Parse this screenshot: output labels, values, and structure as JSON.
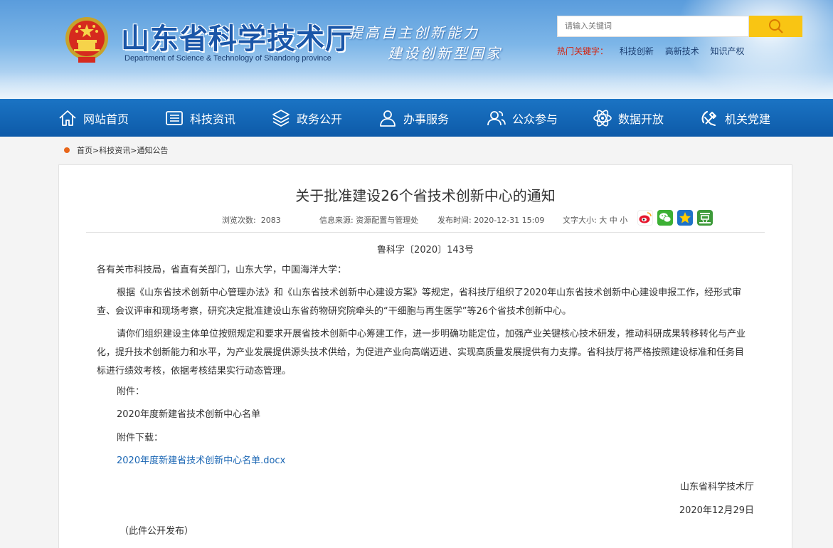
{
  "header": {
    "site_title": "山东省科学技术厅",
    "site_subtitle": "Department of Science & Technology of Shandong province",
    "slogan_line1": "提高自主创新能力",
    "slogan_line2": "建设创新型国家",
    "search_placeholder": "请输入关键词",
    "hot_label": "热门关键字：",
    "hot_keywords": [
      "科技创新",
      "高新技术",
      "知识产权"
    ]
  },
  "nav": {
    "items": [
      {
        "label": "网站首页",
        "icon": "home-icon"
      },
      {
        "label": "科技资讯",
        "icon": "news-icon"
      },
      {
        "label": "政务公开",
        "icon": "layers-icon"
      },
      {
        "label": "办事服务",
        "icon": "user-service-icon"
      },
      {
        "label": "公众参与",
        "icon": "people-icon"
      },
      {
        "label": "数据开放",
        "icon": "atom-icon"
      },
      {
        "label": "机关党建",
        "icon": "party-icon"
      }
    ]
  },
  "breadcrumb": "首页>科技资讯>通知公告",
  "article": {
    "title": "关于批准建设26个省技术创新中心的通知",
    "views_label": "浏览次数:",
    "views": "2083",
    "source_label": "信息来源:",
    "source": "资源配置与管理处",
    "time_label": "发布时间:",
    "time": "2020-12-31 15:09",
    "fontsize_label": "文字大小:",
    "fontsize_options": "大 中 小",
    "doc_number": "鲁科字〔2020〕143号",
    "salutation": "各有关市科技局，省直有关部门，山东大学，中国海洋大学：",
    "paragraph1": "根据《山东省技术创新中心管理办法》和《山东省技术创新中心建设方案》等规定，省科技厅组织了2020年山东省技术创新中心建设申报工作，经形式审查、会议评审和现场考察，研究决定批准建设山东省药物研究院牵头的“干细胞与再生医学”等26个省技术创新中心。",
    "paragraph2": "请你们组织建设主体单位按照规定和要求开展省技术创新中心筹建工作，进一步明确功能定位，加强产业关键核心技术研发，推动科研成果转移转化与产业化，提升技术创新能力和水平，为产业发展提供源头技术供给，为促进产业向高端迈进、实现高质量发展提供有力支撑。省科技厅将严格按照建设标准和任务目标进行绩效考核，依据考核结果实行动态管理。",
    "attachment_label": "附件：",
    "attachment_name": "2020年度新建省技术创新中心名单",
    "download_label": "附件下载：",
    "download_link": "2020年度新建省技术创新中心名单.docx",
    "signature": "山东省科学技术厅",
    "date": "2020年12月29日",
    "footnote": "（此件公开发布）"
  },
  "colors": {
    "nav_blue": "#0d5aa8",
    "title_blue": "#1a56a8",
    "search_yellow": "#f9c513",
    "hot_red": "#d2230f",
    "link_blue": "#1c67b4",
    "crumb_dot": "#e8661a"
  }
}
